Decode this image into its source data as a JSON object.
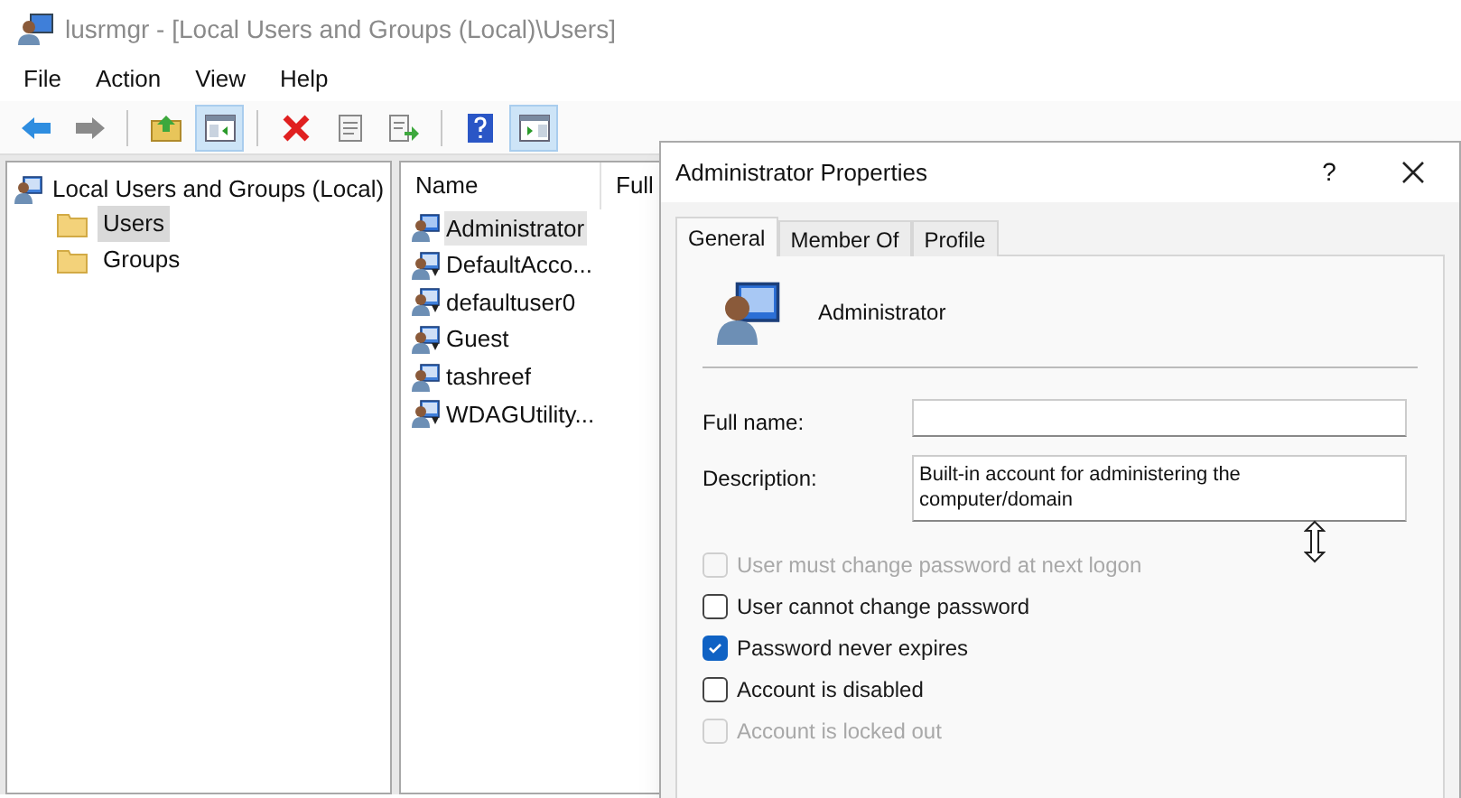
{
  "window": {
    "title": "lusrmgr - [Local Users and Groups (Local)\\Users]"
  },
  "menu": [
    "File",
    "Action",
    "View",
    "Help"
  ],
  "toolbar": [
    {
      "kind": "back",
      "selected": false
    },
    {
      "kind": "forward",
      "selected": false
    },
    {
      "kind": "sep"
    },
    {
      "kind": "up",
      "selected": false
    },
    {
      "kind": "pane",
      "selected": true
    },
    {
      "kind": "sep"
    },
    {
      "kind": "delete",
      "selected": false
    },
    {
      "kind": "properties",
      "selected": false
    },
    {
      "kind": "export",
      "selected": false
    },
    {
      "kind": "sep"
    },
    {
      "kind": "help",
      "selected": false
    },
    {
      "kind": "action-pane",
      "selected": true
    }
  ],
  "tree": {
    "label": "Local Users and Groups (Local)",
    "children": [
      {
        "label": "Users",
        "selected": true
      },
      {
        "label": "Groups",
        "selected": false
      }
    ]
  },
  "list": {
    "columns": [
      "Name",
      "Full"
    ],
    "rows": [
      {
        "name": "Administrator",
        "selected": true,
        "kind": "admin"
      },
      {
        "name": "DefaultAcco...",
        "selected": false,
        "kind": "disabled"
      },
      {
        "name": "defaultuser0",
        "selected": false,
        "kind": "disabled"
      },
      {
        "name": "Guest",
        "selected": false,
        "kind": "disabled"
      },
      {
        "name": "tashreef",
        "selected": false,
        "kind": "user"
      },
      {
        "name": "WDAGUtility...",
        "selected": false,
        "kind": "disabled"
      }
    ]
  },
  "dialog": {
    "title": "Administrator Properties",
    "help": "?",
    "tabs": [
      {
        "label": "General",
        "selected": true
      },
      {
        "label": "Member Of",
        "selected": false
      },
      {
        "label": "Profile",
        "selected": false
      }
    ],
    "user_name": "Administrator",
    "fields": [
      {
        "label": "Full name:"
      },
      {
        "label": "Description:",
        "value": "Built-in account for administering the computer/domain"
      }
    ],
    "checkboxes": [
      {
        "label": "User must change password at next logon",
        "checked": false,
        "disabled": true
      },
      {
        "label": "User cannot change password",
        "checked": false,
        "disabled": false
      },
      {
        "label": "Password never expires",
        "checked": true,
        "disabled": false
      },
      {
        "label": "Account is disabled",
        "checked": false,
        "disabled": false
      },
      {
        "label": "Account is locked out",
        "checked": false,
        "disabled": true
      }
    ]
  }
}
